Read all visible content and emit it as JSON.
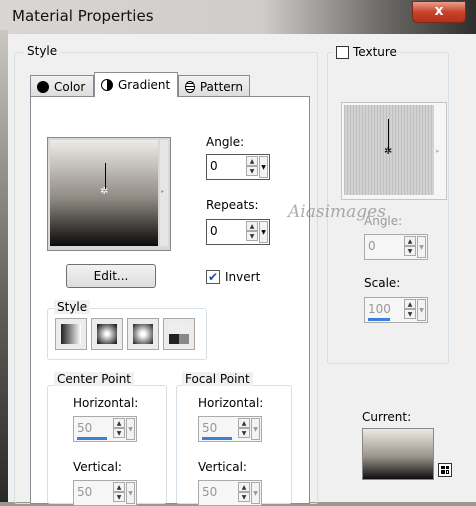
{
  "window": {
    "title": "Material Properties",
    "close_label": "x"
  },
  "style_group": {
    "label": "Style"
  },
  "tabs": [
    {
      "label": "Color",
      "icon": "color-circle-icon"
    },
    {
      "label": "Gradient",
      "icon": "gradient-circle-icon"
    },
    {
      "label": "Pattern",
      "icon": "pattern-globe-icon"
    }
  ],
  "gradient": {
    "angle_label": "Angle:",
    "angle_value": "0",
    "repeats_label": "Repeats:",
    "repeats_value": "0",
    "edit_label": "Edit...",
    "invert_label": "Invert",
    "invert_checked": true,
    "style_label": "Style",
    "center_point": {
      "label": "Center Point",
      "horizontal_label": "Horizontal:",
      "horizontal_value": "50",
      "vertical_label": "Vertical:",
      "vertical_value": "50"
    },
    "focal_point": {
      "label": "Focal Point",
      "horizontal_label": "Horizontal:",
      "horizontal_value": "50",
      "vertical_label": "Vertical:",
      "vertical_value": "50"
    }
  },
  "texture": {
    "label": "Texture",
    "checked": false,
    "angle_label": "Angle:",
    "angle_value": "0",
    "scale_label": "Scale:",
    "scale_value": "100",
    "watermark": "Aiasimages"
  },
  "current": {
    "label": "Current:"
  },
  "colors": {
    "accent": "#3a7fd8",
    "close": "#c9432a"
  }
}
